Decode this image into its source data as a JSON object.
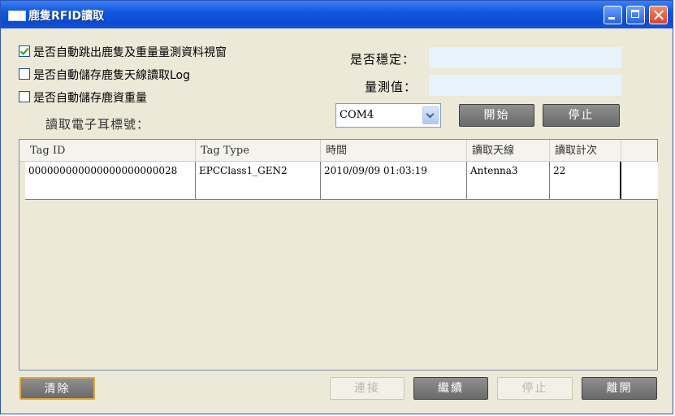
{
  "window": {
    "title": "鹿隻RFID讀取"
  },
  "options": [
    {
      "label": "是否自動跳出鹿隻及重量量測資料視窗",
      "checked": true
    },
    {
      "label": "是否自動儲存鹿隻天線讀取Log",
      "checked": false
    },
    {
      "label": "是否自動儲存鹿資重量",
      "checked": false
    }
  ],
  "read_tag_label": "讀取電子耳標號：",
  "stable_label": "是否穩定：",
  "measure_label": "量測值：",
  "stable_value": "",
  "measure_value": "",
  "port": {
    "selected": "COM4"
  },
  "top_buttons": {
    "start": "開始",
    "stop": "停止"
  },
  "table": {
    "columns": [
      "Tag ID",
      "Tag Type",
      "時間",
      "讀取天線",
      "讀取計次"
    ],
    "rows": [
      [
        "000000000000000000000028",
        "EPCClass1_GEN2",
        "2010/09/09 01:03:19",
        "Antenna3",
        "22"
      ],
      [
        "",
        "",
        "",
        "",
        ""
      ]
    ]
  },
  "bottom_buttons": {
    "clear": "清除",
    "connect": "連接",
    "continue": "繼續",
    "stop": "停止",
    "exit": "離開"
  }
}
